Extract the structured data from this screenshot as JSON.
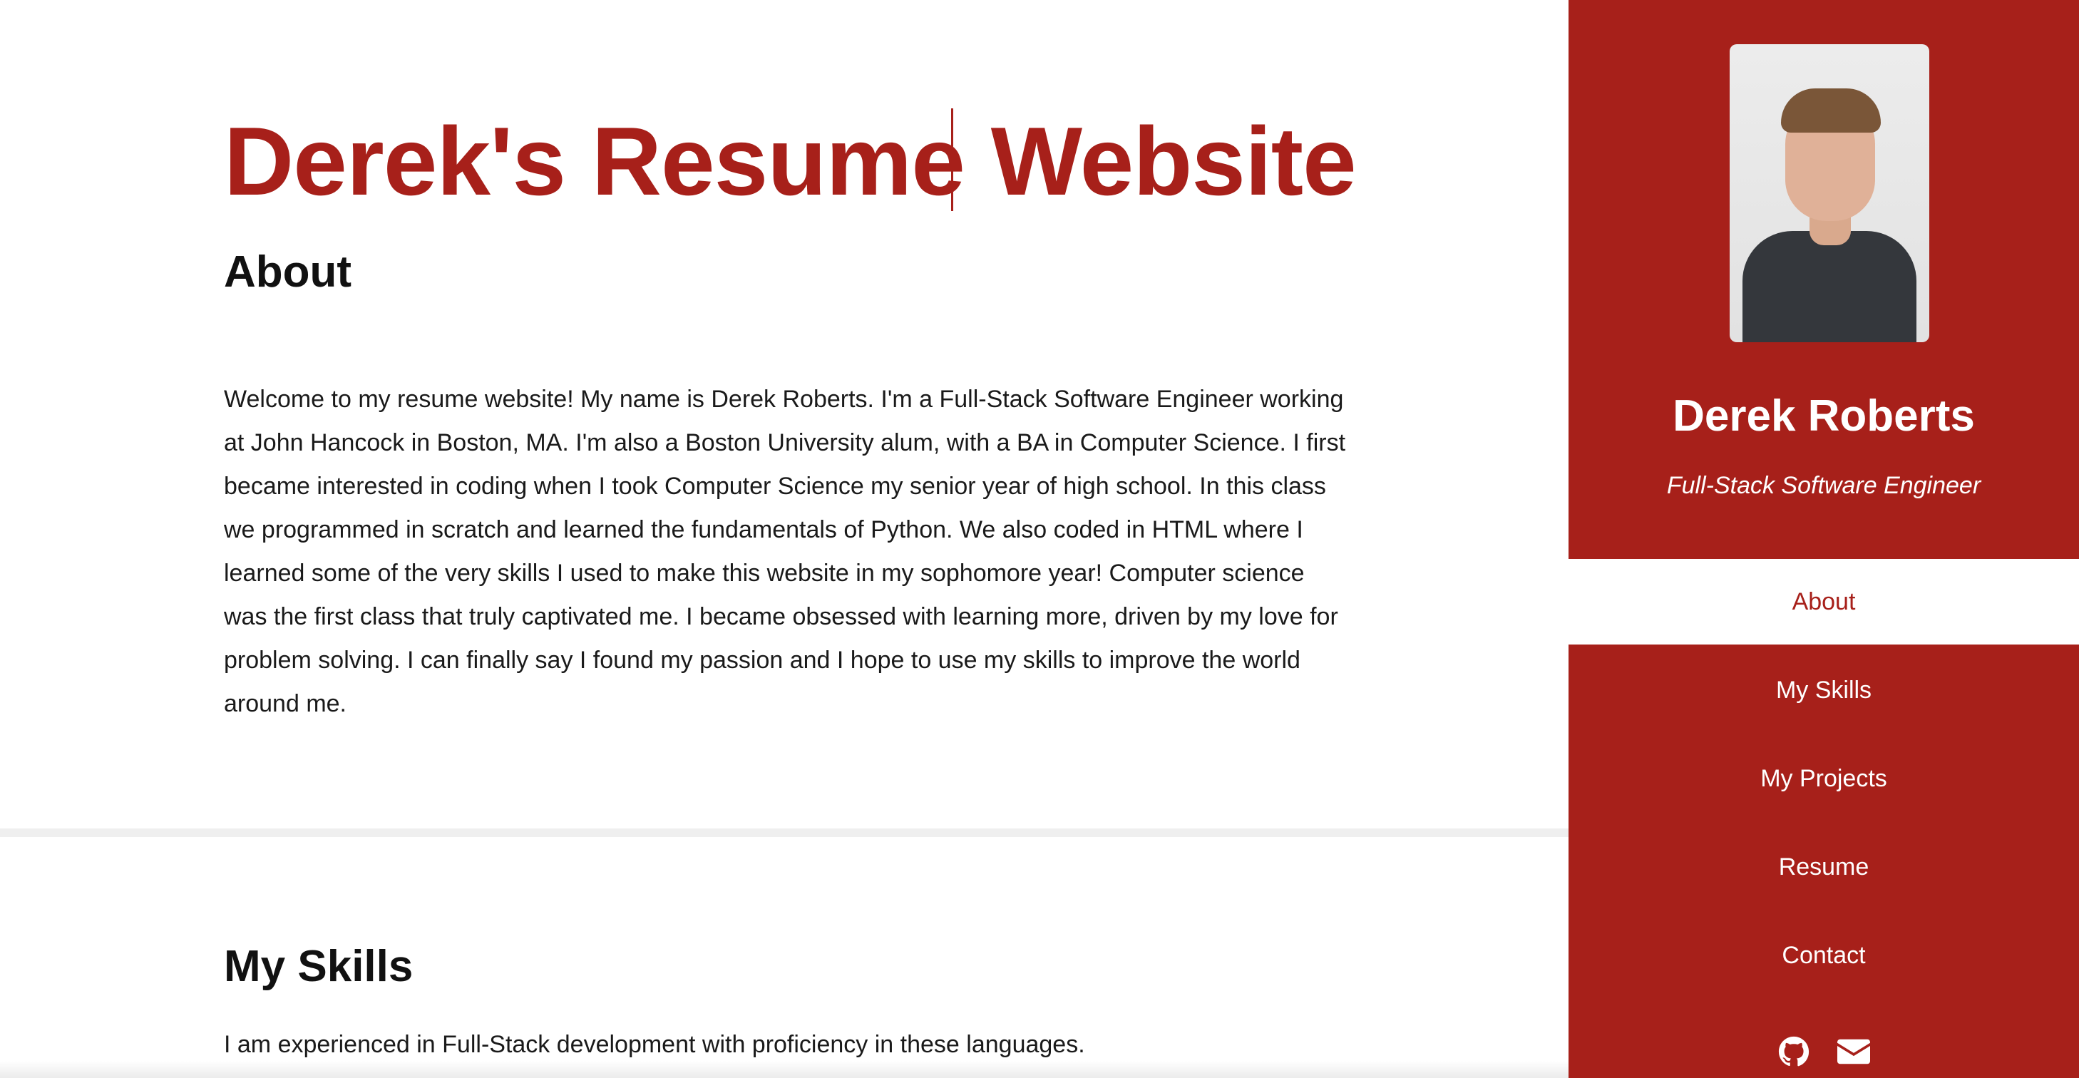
{
  "main": {
    "title": "Derek's Resume Website",
    "about": {
      "heading": "About",
      "text": "Welcome to my resume website! My name is Derek Roberts. I'm a Full-Stack Software Engineer working at John Hancock in Boston, MA. I'm also a Boston University alum, with a BA in Computer Science. I first became interested in coding when I took Computer Science my senior year of high school. In this class we programmed in scratch and learned the fundamentals of Python. We also coded in HTML where I learned some of the very skills I used to make this website in my sophomore year! Computer science was the first class that truly captivated me. I became obsessed with learning more, driven by my love for problem solving. I can finally say I found my passion and I hope to use my skills to improve the world around me."
    },
    "skills": {
      "heading": "My Skills",
      "text": "I am experienced in Full-Stack development with proficiency in these languages."
    }
  },
  "sidebar": {
    "name": "Derek Roberts",
    "title": "Full-Stack Software Engineer",
    "nav": [
      {
        "label": "About",
        "active": true
      },
      {
        "label": "My Skills",
        "active": false
      },
      {
        "label": "My Projects",
        "active": false
      },
      {
        "label": "Resume",
        "active": false
      },
      {
        "label": "Contact",
        "active": false
      }
    ],
    "social_icons": [
      "github-icon",
      "envelope-icon"
    ]
  },
  "colors": {
    "accent": "#a7201a",
    "background": "#ffffff",
    "text": "#1a1a1a",
    "divider": "#efefef"
  }
}
